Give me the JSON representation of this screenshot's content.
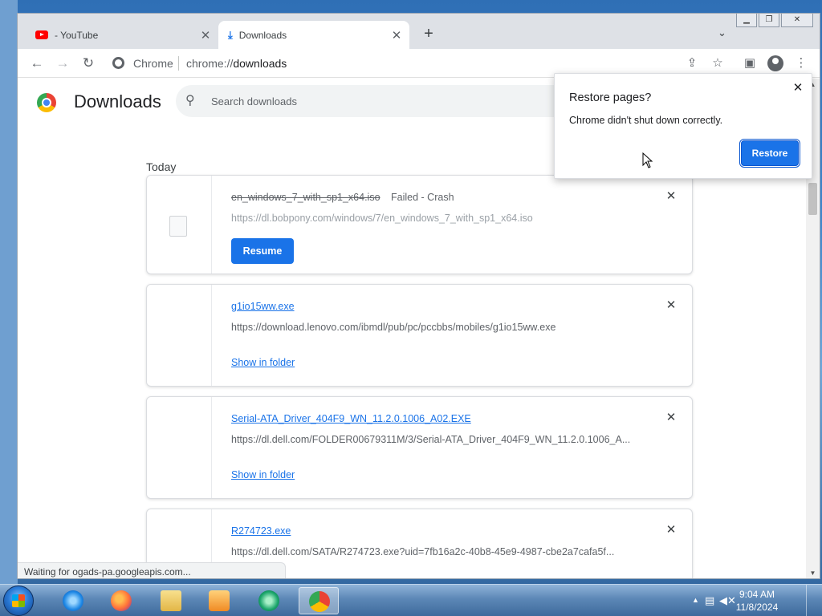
{
  "browser": {
    "tabs": [
      {
        "label": "- YouTube"
      },
      {
        "label": "Downloads"
      }
    ],
    "toolbar": {
      "site_chip": "Chrome",
      "url_scheme": "chrome://",
      "url_path": "downloads"
    }
  },
  "downloads_page": {
    "title": "Downloads",
    "search_placeholder": "Search downloads",
    "date_group": "Today",
    "items": [
      {
        "filename": "en_windows_7_with_sp1_x64.iso",
        "status": "Failed - Crash",
        "url": "https://dl.bobpony.com/windows/7/en_windows_7_with_sp1_x64.iso",
        "action": "Resume"
      },
      {
        "filename": "g1io15ww.exe",
        "url": "https://download.lenovo.com/ibmdl/pub/pc/pccbbs/mobiles/g1io15ww.exe",
        "action": "Show in folder"
      },
      {
        "filename": "Serial-ATA_Driver_404F9_WN_11.2.0.1006_A02.EXE",
        "url": "https://dl.dell.com/FOLDER00679311M/3/Serial-ATA_Driver_404F9_WN_11.2.0.1006_A...",
        "action": "Show in folder"
      },
      {
        "filename": "R274723.exe",
        "url": "https://dl.dell.com/SATA/R274723.exe?uid=7fb16a2c-40b8-45e9-4987-cbe2a7cafa5f..."
      }
    ]
  },
  "restore_popup": {
    "title": "Restore pages?",
    "message": "Chrome didn't shut down correctly.",
    "button": "Restore"
  },
  "status_bubble": "Waiting for ogads-pa.googleapis.com...",
  "taskbar": {
    "apps": [
      "internet-explorer",
      "firefox",
      "file-explorer",
      "media-player",
      "edge-like-app",
      "chrome"
    ],
    "clock_time": "9:04 AM",
    "clock_date": "11/8/2024"
  },
  "colors": {
    "accent": "#1a73e8",
    "tabstrip": "#dee1e6"
  }
}
